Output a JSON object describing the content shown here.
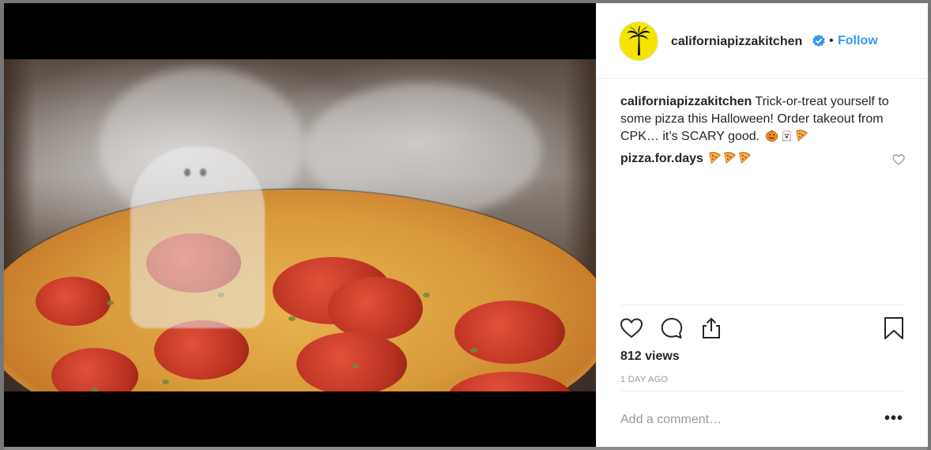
{
  "post": {
    "username": "californiapizzakitchen",
    "follow_label": "Follow",
    "separator": "•",
    "caption_username": "californiapizzakitchen",
    "caption_text": " Trick-or-treat yourself to some pizza this Halloween! Order takeout from CPK… it’s SCARY good.",
    "comment_username": "pizza.for.days",
    "views": "812 views",
    "timestamp": "1 DAY AGO",
    "add_comment_placeholder": "Add a comment…",
    "more_label": "•••"
  },
  "colors": {
    "accent": "#3897f0",
    "avatar_bg": "#f5e400",
    "text": "#262626",
    "muted": "#999999"
  },
  "icons": {
    "verified": "verified-badge-icon",
    "like": "heart-icon",
    "comment": "comment-bubble-icon",
    "share": "share-icon",
    "save": "bookmark-icon",
    "logo": "palm-tree-icon",
    "caption_emoji": [
      "jack-o-lantern-icon",
      "ghost-icon",
      "pizza-icon"
    ],
    "comment_emoji": [
      "pizza-icon",
      "pizza-icon",
      "pizza-icon"
    ]
  }
}
